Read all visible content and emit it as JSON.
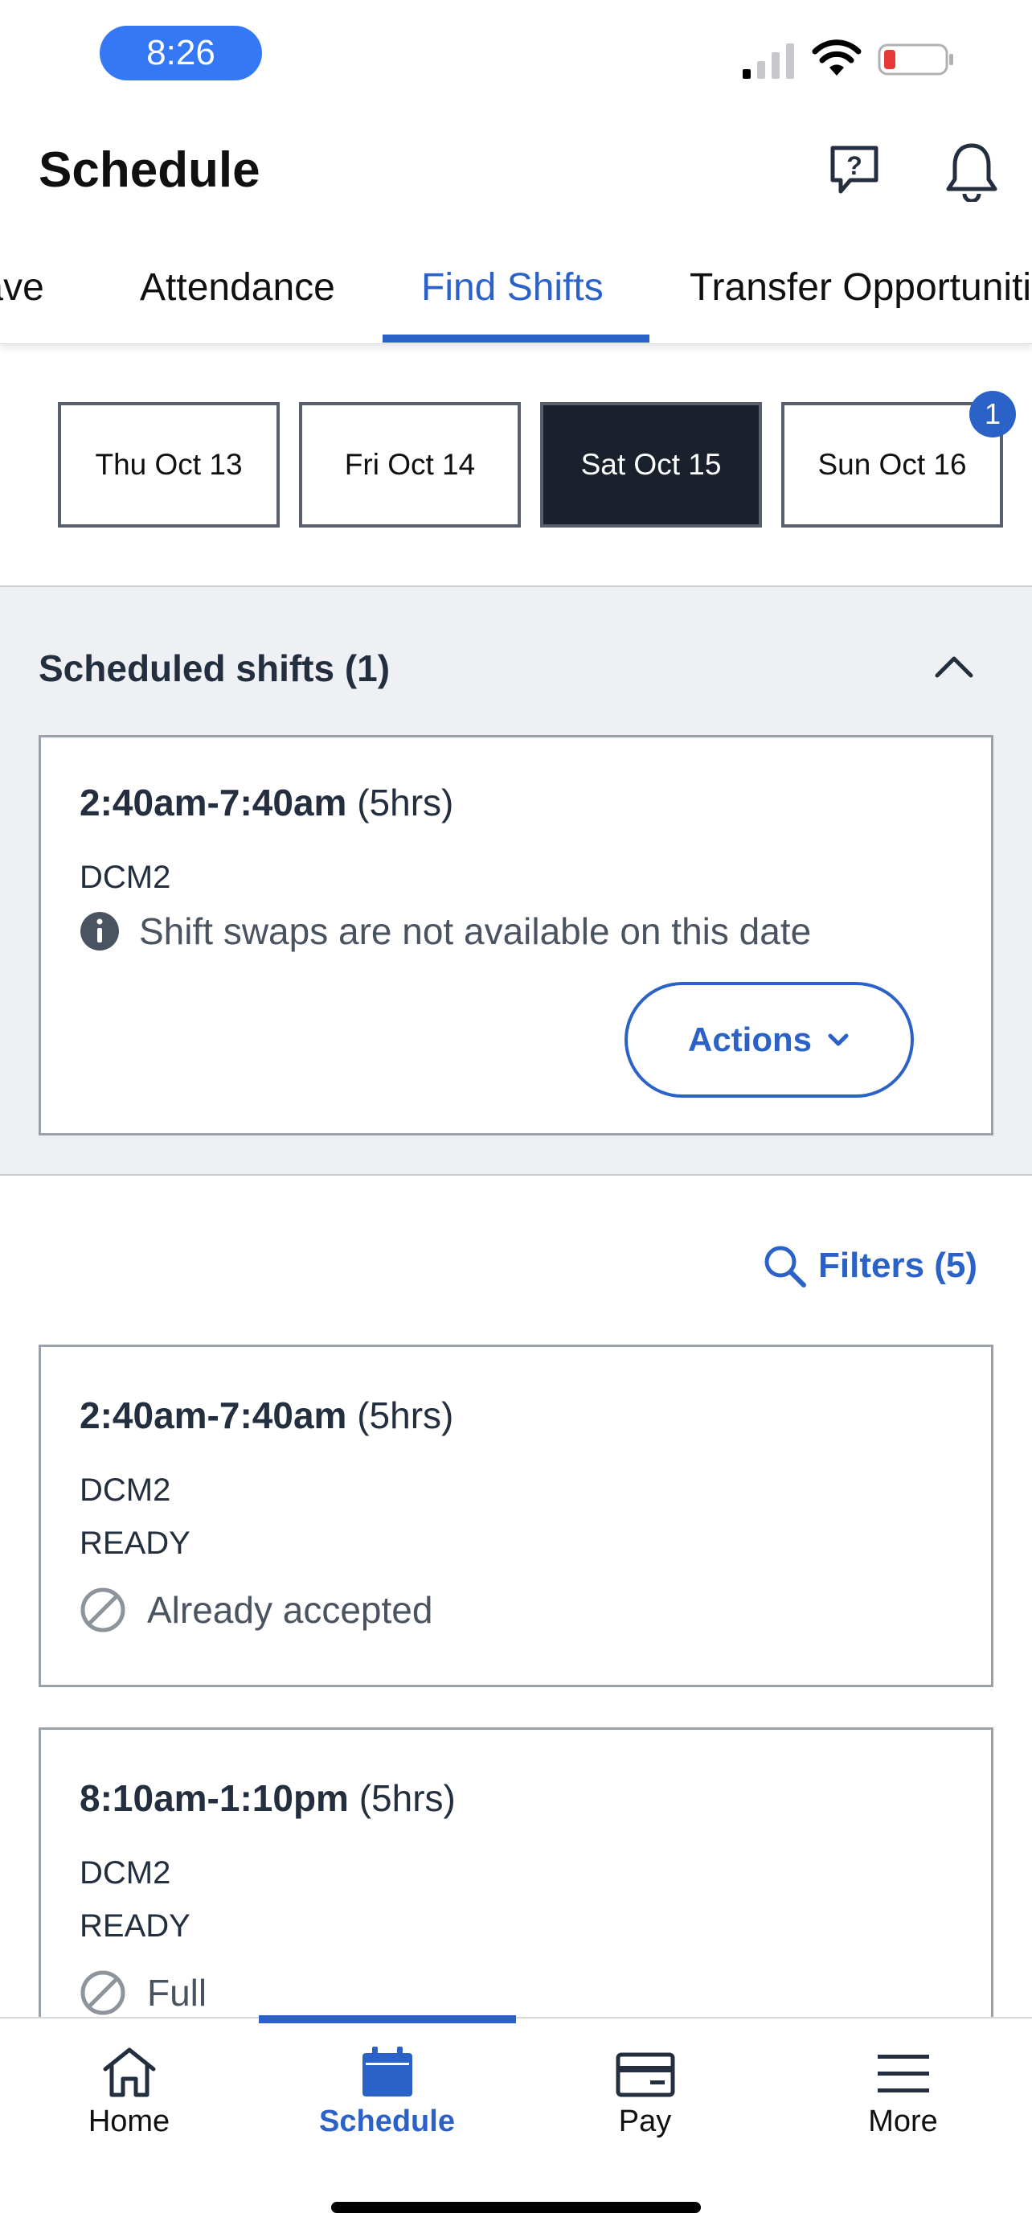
{
  "status_bar": {
    "time": "8:26"
  },
  "header": {
    "title": "Schedule"
  },
  "tabs": [
    {
      "label": "Leave"
    },
    {
      "label": "Attendance"
    },
    {
      "label": "Find Shifts",
      "active": true
    },
    {
      "label": "Transfer Opportunities"
    }
  ],
  "dates": [
    {
      "label": "Thu Oct 13"
    },
    {
      "label": "Fri Oct 14"
    },
    {
      "label": "Sat Oct 15",
      "selected": true
    },
    {
      "label": "Sun Oct 16",
      "badge": "1"
    }
  ],
  "scheduled": {
    "title": "Scheduled shifts (1)",
    "card": {
      "time": "2:40am-7:40am",
      "duration": "(5hrs)",
      "site": "DCM2",
      "info": "Shift swaps are not available on this date",
      "actions_label": "Actions"
    }
  },
  "filters_label": "Filters (5)",
  "shifts": [
    {
      "time": "2:40am-7:40am",
      "duration": "(5hrs)",
      "site": "DCM2",
      "status": "READY",
      "availability": "Already accepted"
    },
    {
      "time": "8:10am-1:10pm",
      "duration": "(5hrs)",
      "site": "DCM2",
      "status": "READY",
      "availability": "Full"
    }
  ],
  "bottom_nav": [
    {
      "label": "Home",
      "icon": "home-icon"
    },
    {
      "label": "Schedule",
      "icon": "calendar-icon",
      "active": true
    },
    {
      "label": "Pay",
      "icon": "wallet-icon"
    },
    {
      "label": "More",
      "icon": "menu-icon"
    }
  ],
  "colors": {
    "accent": "#2b62c8",
    "selected_date_bg": "#1a202c",
    "section_bg": "#eef0f3"
  }
}
